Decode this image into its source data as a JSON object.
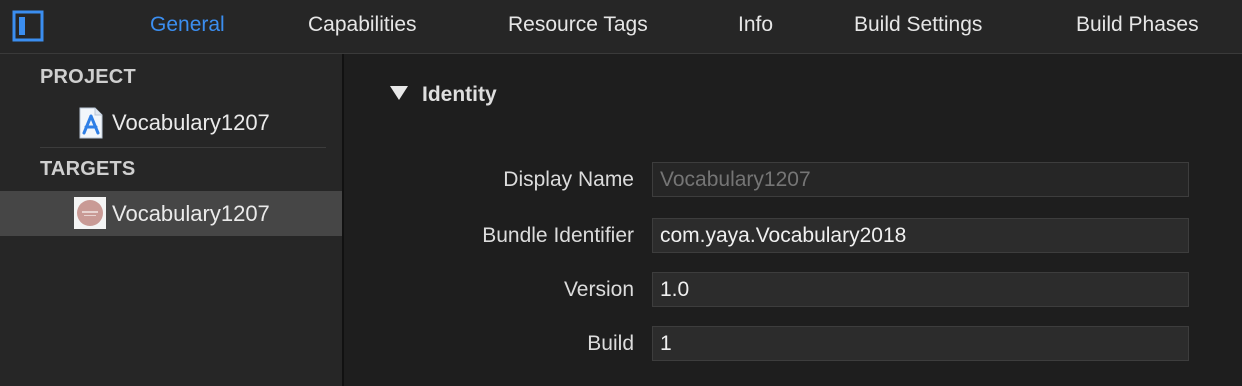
{
  "colors": {
    "accent": "#3b8ef0",
    "background": "#1e1e1e",
    "sidebar_bg": "#262626",
    "selected_row": "#464646"
  },
  "toolbar": {
    "sidebar_toggle_icon": "sidebar-toggle-icon",
    "tabs": [
      {
        "label": "General",
        "active": true
      },
      {
        "label": "Capabilities",
        "active": false
      },
      {
        "label": "Resource Tags",
        "active": false
      },
      {
        "label": "Info",
        "active": false
      },
      {
        "label": "Build Settings",
        "active": false
      },
      {
        "label": "Build Phases",
        "active": false
      }
    ]
  },
  "sidebar": {
    "project_header": "PROJECT",
    "project_item": {
      "label": "Vocabulary1207",
      "icon": "xcode-project-icon"
    },
    "targets_header": "TARGETS",
    "target_item": {
      "label": "Vocabulary1207",
      "icon": "app-target-icon",
      "selected": true
    }
  },
  "identity": {
    "title": "Identity",
    "fields": [
      {
        "label": "Display Name",
        "value": "",
        "placeholder": "Vocabulary1207"
      },
      {
        "label": "Bundle Identifier",
        "value": "com.yaya.Vocabulary2018"
      },
      {
        "label": "Version",
        "value": "1.0"
      },
      {
        "label": "Build",
        "value": "1"
      }
    ]
  }
}
